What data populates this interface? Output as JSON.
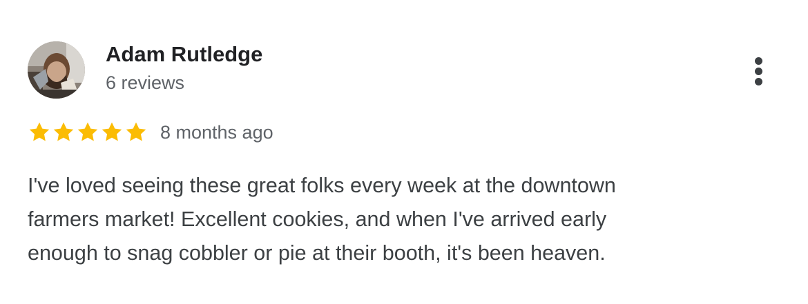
{
  "review": {
    "author_name": "Adam Rutledge",
    "review_count": "6 reviews",
    "rating": 5,
    "rating_max": 5,
    "time_ago": "8 months ago",
    "text_lines": [
      "I've loved seeing these great folks every week at the downtown",
      "farmers market! Excellent cookies, and when I've arrived early",
      "enough to snag cobbler or pie at their booth, it's been heaven."
    ]
  },
  "icons": {
    "avatar": "avatar-photo",
    "star": "star-icon",
    "more": "more-vert-icon"
  },
  "colors": {
    "star": "#FBBC04",
    "name": "#202124",
    "secondary": "#5F6368",
    "body": "#3C4043"
  }
}
